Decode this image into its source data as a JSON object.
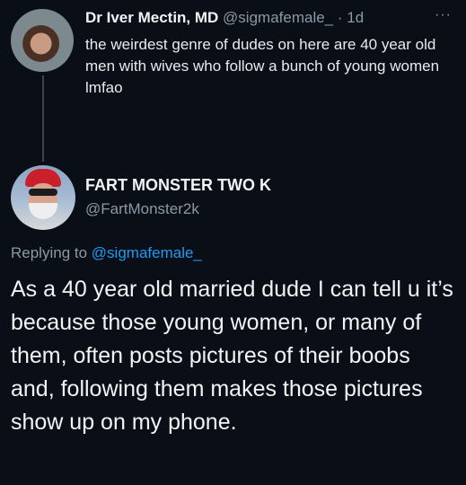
{
  "tweet": {
    "author_name": "Dr Iver Mectin, MD",
    "author_handle": "@sigmafemale_",
    "separator": "·",
    "timestamp": "1d",
    "more_icon": "···",
    "text": "the weirdest genre of dudes on here are 40 year old men with wives who follow a bunch of young women lmfao"
  },
  "reply": {
    "author_name": "FART MONSTER TWO K",
    "author_handle": "@FartMonster2k",
    "replying_prefix": "Replying to",
    "replying_handle": "@sigmafemale_",
    "text": "As a 40 year old married dude I can tell u it’s because those young women, or many of them, often posts pictures of their boobs and, following them makes those pictures show up on my phone."
  },
  "colors": {
    "background": "#0a0f17",
    "link": "#1d9bf0",
    "secondary_text": "#8b98a5"
  }
}
